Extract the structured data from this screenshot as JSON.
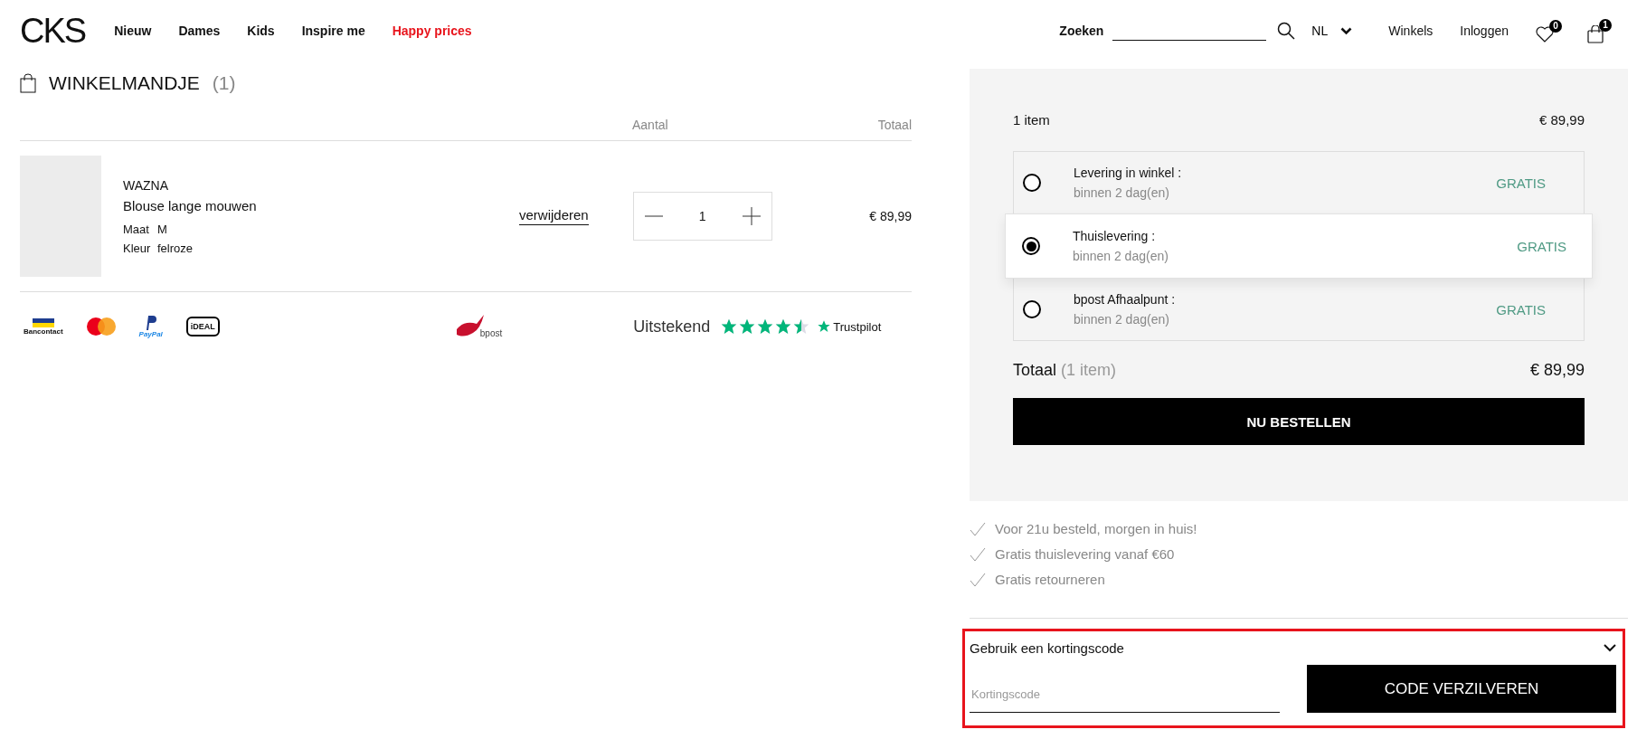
{
  "header": {
    "logo": "CKS",
    "nav": [
      {
        "label": "Nieuw",
        "kind": "normal"
      },
      {
        "label": "Dames",
        "kind": "normal"
      },
      {
        "label": "Kids",
        "kind": "normal"
      },
      {
        "label": "Inspire me",
        "kind": "normal"
      },
      {
        "label": "Happy prices",
        "kind": "sale"
      }
    ],
    "search_label": "Zoeken",
    "language": "NL",
    "links": [
      "Winkels",
      "Inloggen"
    ],
    "wishlist_count": "0",
    "cart_count": "1"
  },
  "cart": {
    "title": "WINKELMANDJE",
    "count": "(1)",
    "columns": [
      "Aantal",
      "Totaal"
    ],
    "items": [
      {
        "brand": "WAZNA",
        "name": "Blouse lange mouwen",
        "attributes": [
          {
            "label": "Maat",
            "value": "M"
          },
          {
            "label": "Kleur",
            "value": "felroze"
          }
        ],
        "remove": "verwijderen",
        "quantity": "1",
        "total": "€ 89,99"
      }
    ],
    "payment_methods": [
      "Bancontact",
      "PayPal",
      "iDEAL"
    ],
    "carrier": "bpost",
    "rating_label": "Uitstekend",
    "stars": 4.5,
    "rating_brand": "Trustpilot"
  },
  "summary": {
    "items_label": "1 item",
    "items_total": "€ 89,99",
    "delivery_options": [
      {
        "name": "Levering in winkel :",
        "time": "binnen 2 dag(en)",
        "price": "GRATIS",
        "selected": false
      },
      {
        "name": "Thuislevering :",
        "time": "binnen 2 dag(en)",
        "price": "GRATIS",
        "selected": true
      },
      {
        "name": "bpost Afhaalpunt :",
        "time": "binnen 2 dag(en)",
        "price": "GRATIS",
        "selected": false
      }
    ],
    "total_label": "Totaal",
    "total_count": "(1 item)",
    "total": "€ 89,99",
    "order_button": "NU BESTELLEN"
  },
  "benefits": [
    "Voor 21u besteld, morgen in huis!",
    "Gratis thuislevering vanaf €60",
    "Gratis retourneren"
  ],
  "coupon": {
    "title": "Gebruik een kortingscode",
    "expanded": true,
    "highlighted": true,
    "placeholder": "Kortingscode",
    "button": "CODE VERZILVEREN"
  }
}
